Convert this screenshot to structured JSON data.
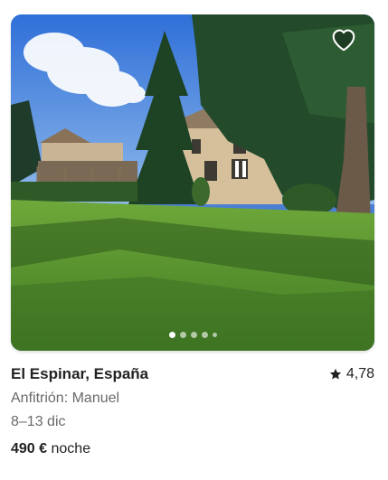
{
  "listing": {
    "location": "El Espinar, España",
    "rating": "4,78",
    "host": "Anfitrión: Manuel",
    "dates": "8–13 dic",
    "price": "490 €",
    "price_unit": "noche"
  },
  "carousel": {
    "total_dots": 5,
    "active_index": 0
  },
  "icons": {
    "favorite": "heart-outline-icon",
    "rating": "star-icon"
  },
  "colors": {
    "text_primary": "#222222",
    "text_secondary": "#6a6a6a"
  }
}
